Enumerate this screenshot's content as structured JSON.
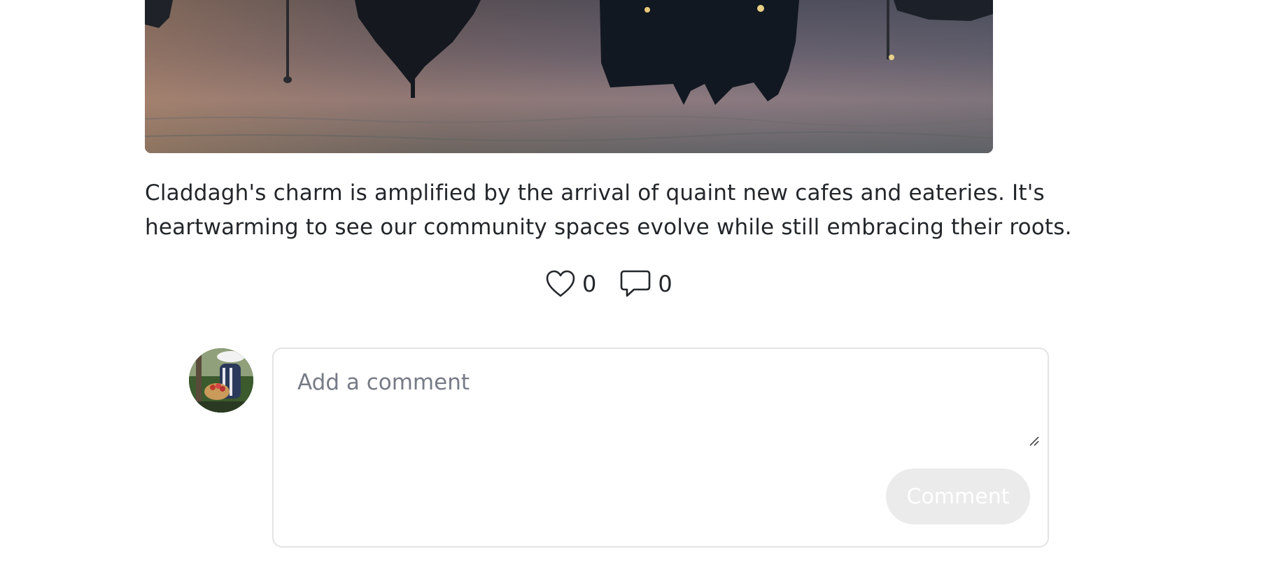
{
  "post": {
    "image_alt": "Reflection of buildings in water at dusk",
    "text_line_1": "Claddagh's charm is amplified by the arrival of quaint new cafes and eateries. It's",
    "text_line_2": "heartwarming to see our community spaces evolve while still embracing their roots."
  },
  "reactions": {
    "likes": {
      "icon": "heart-icon",
      "count": "0"
    },
    "comments": {
      "icon": "speech-bubble-icon",
      "count": "0"
    }
  },
  "comment_form": {
    "avatar_icon": "user-avatar",
    "placeholder": "Add a comment",
    "value": "",
    "submit_label": "Comment"
  },
  "colors": {
    "text": "#23262a",
    "placeholder": "#767b86",
    "border": "#e4e4e4",
    "button_disabled_bg": "#ebebeb",
    "button_disabled_text": "#ffffff"
  }
}
